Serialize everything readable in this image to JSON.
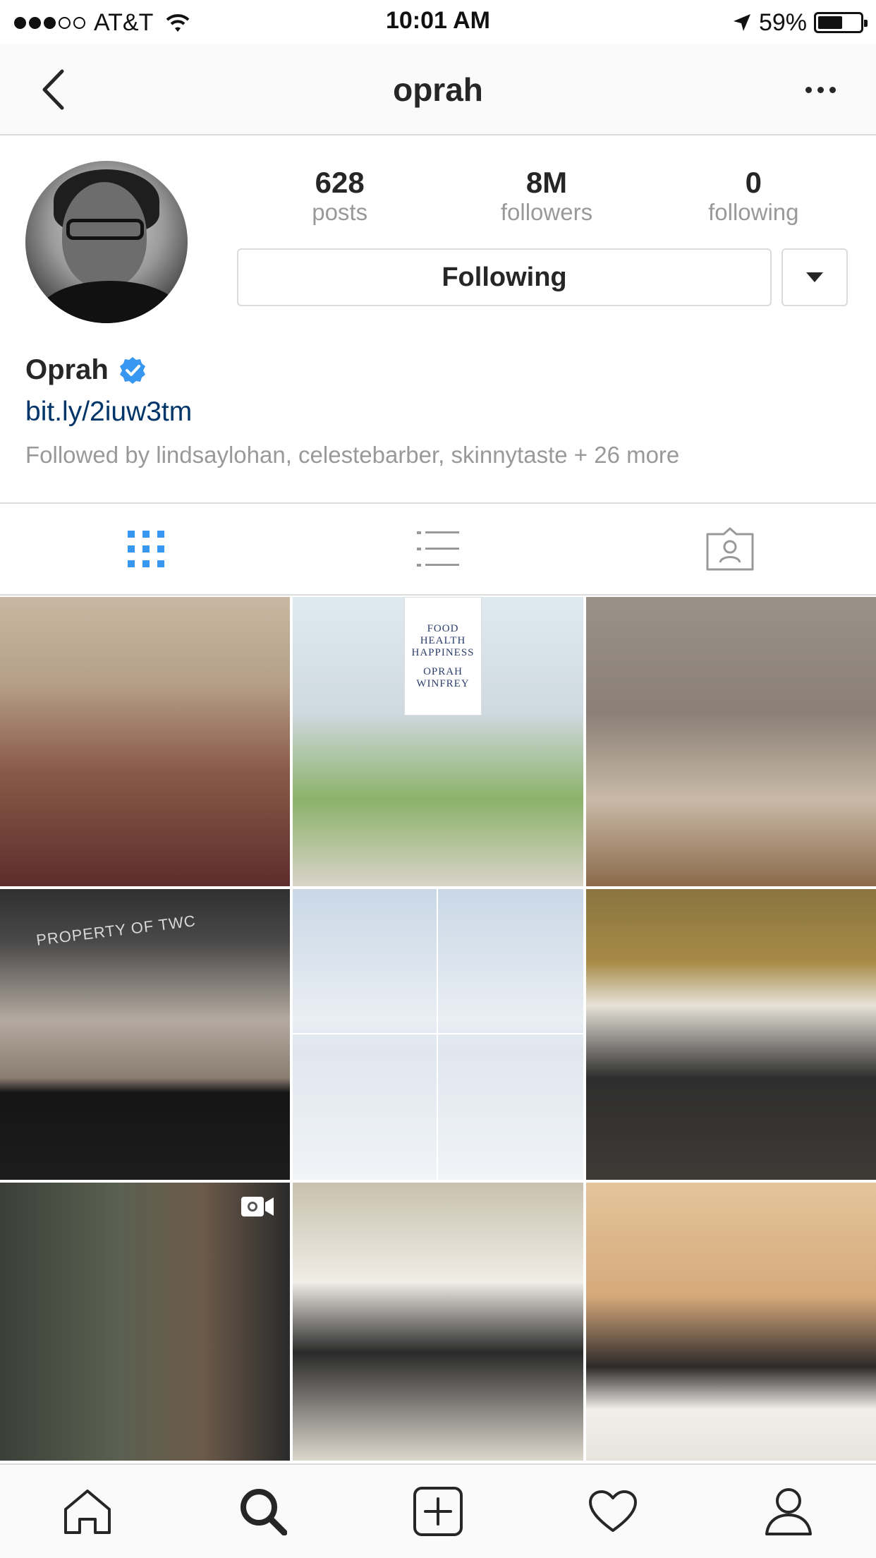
{
  "status_bar": {
    "carrier": "AT&T",
    "time": "10:01 AM",
    "battery_percent": "59%",
    "battery_level": 0.59,
    "signal_bars_filled": 3,
    "signal_bars_total": 5
  },
  "nav": {
    "title": "oprah",
    "back_icon": "chevron-left-icon",
    "more_icon": "more-horizontal-icon"
  },
  "profile": {
    "stats": [
      {
        "value": "628",
        "label": "posts"
      },
      {
        "value": "8M",
        "label": "followers"
      },
      {
        "value": "0",
        "label": "following"
      }
    ],
    "following_button_label": "Following",
    "display_name": "Oprah",
    "verified": true,
    "bio_link": "bit.ly/2iuw3tm",
    "followed_by": "Followed by lindsaylohan, celestebarber, skinnytaste + 26 more"
  },
  "tabs": [
    {
      "icon": "grid-icon",
      "active": true
    },
    {
      "icon": "list-icon",
      "active": false
    },
    {
      "icon": "tagged-icon",
      "active": false
    }
  ],
  "grid": {
    "book_title": "FOOD HEALTH HAPPINESS",
    "book_author": "OPRAH WINFREY",
    "video_caption": "PROPERTY OF TWC"
  },
  "bottom_bar": [
    {
      "icon": "home-icon"
    },
    {
      "icon": "search-icon",
      "active": true
    },
    {
      "icon": "add-post-icon"
    },
    {
      "icon": "heart-icon"
    },
    {
      "icon": "profile-icon"
    }
  ],
  "colors": {
    "accent_blue": "#3897f0",
    "link_blue": "#003569",
    "text_dark": "#262626",
    "text_gray": "#999999",
    "border": "#dbdbdb"
  }
}
